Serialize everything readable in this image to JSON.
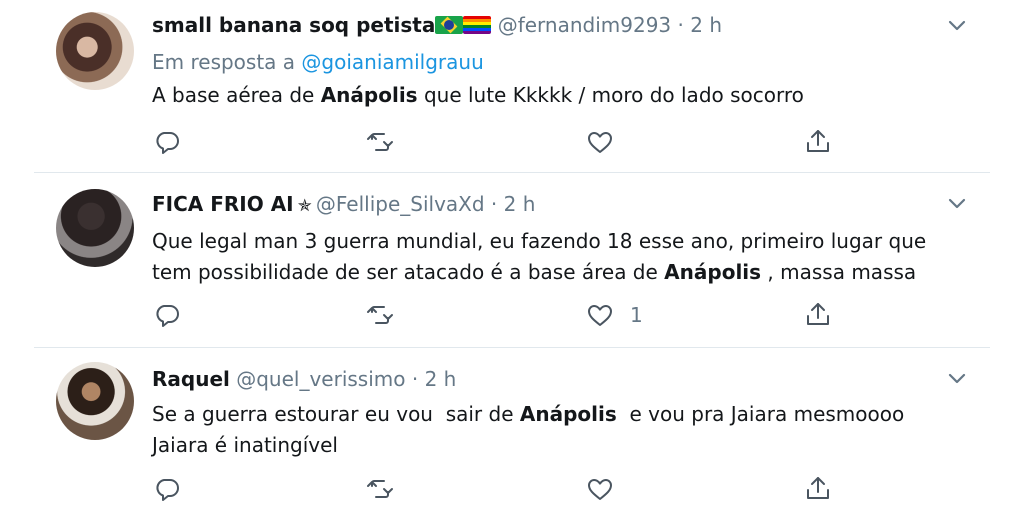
{
  "tweets": [
    {
      "name": "small banana soq petista",
      "flags": [
        "brazil-flag",
        "rainbow-flag"
      ],
      "handle": "@fernandim9293",
      "dot": "·",
      "time": "2 h",
      "reply_prefix": "Em resposta a",
      "reply_to": "@goianiamilgrauu",
      "text_before": "A base aérea de ",
      "text_bold": "Anápolis",
      "text_after": " que lute Kkkkk / moro do lado socorro",
      "like_count": ""
    },
    {
      "name": "FICA FRIO AI",
      "badge": "✯",
      "handle": "@Fellipe_SilvaXd",
      "dot": "·",
      "time": "2 h",
      "text_line1": "Que legal man 3 guerra mundial, eu fazendo 18 esse ano, primeiro lugar que",
      "text_line2_before": "tem possibilidade de ser atacado é a base área de ",
      "text_bold": "Anápolis",
      "text_line2_after": " , massa massa",
      "like_count": "1"
    },
    {
      "name": "Raquel",
      "handle": "@quel_verissimo",
      "dot": "·",
      "time": "2 h",
      "text_line1_before": "Se a guerra estourar eu vou  sair de ",
      "text_bold": "Anápolis",
      "text_line1_after": "  e vou pra Jaiara mesmoooo",
      "text_line2": "Jaiara é inatingível",
      "like_count": ""
    }
  ],
  "icons": {
    "reply": "reply-icon",
    "retweet": "retweet-icon",
    "like": "heart-icon",
    "share": "share-icon",
    "menu": "chevron-down-icon"
  },
  "colors": {
    "text": "#14171a",
    "secondary": "#657786",
    "link": "#1b95e0",
    "divider": "#e1e8ed"
  }
}
